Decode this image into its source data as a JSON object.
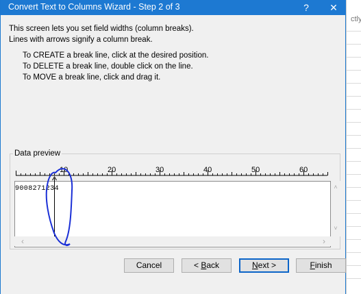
{
  "window": {
    "title": "Convert Text to Columns Wizard - Step 2 of 3",
    "help_label": "?",
    "close_label": "✕"
  },
  "background": {
    "partial_text": "ctly"
  },
  "intro": {
    "line1": "This screen lets you set field widths (column breaks).",
    "line2": "Lines with arrows signify a column break."
  },
  "instructions": {
    "create": "To CREATE a break line, click at the desired position.",
    "delete": "To DELETE a break line, double click on the line.",
    "move": "To MOVE a break line, click and drag it."
  },
  "preview": {
    "label": "Data preview",
    "ruler_labels": [
      "10",
      "20",
      "30",
      "40",
      "50",
      "60"
    ],
    "rows": [
      "9008271234"
    ],
    "break_positions": [
      8
    ]
  },
  "buttons": {
    "cancel": "Cancel",
    "back_mnemonic": "B",
    "back_prefix": "< ",
    "back_rest": "ack",
    "next_mnemonic": "N",
    "next_rest": "ext >",
    "finish_mnemonic": "F",
    "finish_rest": "inish"
  },
  "colors": {
    "titlebar": "#1d79d2",
    "dialog_bg": "#f0f0f0",
    "annotation": "#1a2fd6",
    "primary_border": "#0a64c8"
  }
}
